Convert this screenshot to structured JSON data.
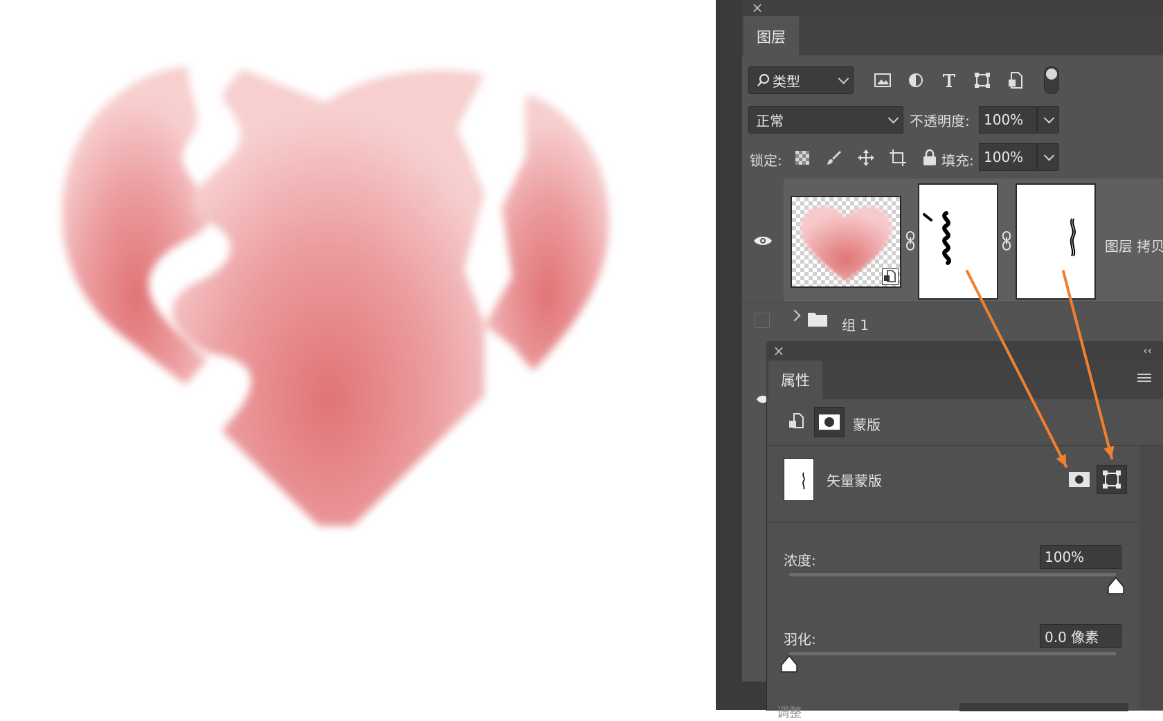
{
  "layers": {
    "tab_label": "图层",
    "filter_label": "类型",
    "blend_mode": "正常",
    "opacity_label": "不透明度:",
    "opacity_value": "100%",
    "lock_label": "锁定:",
    "fill_label": "填充:",
    "fill_value": "100%",
    "layer_name": "图层 拷贝",
    "group_name": "组 1"
  },
  "properties": {
    "tab_label": "属性",
    "mask_label": "蒙版",
    "vector_mask_label": "矢量蒙版",
    "density_label": "浓度:",
    "density_value": "100%",
    "density_percent": 100,
    "feather_label": "羽化:",
    "feather_value": "0.0 像素",
    "feather_percent": 0,
    "cut_label": "调整"
  },
  "colors": {
    "annotation_arrow": "#f08030",
    "heart_dark": "#e07476",
    "heart_light": "#f7cfcf"
  },
  "icons": [
    "close-icon",
    "search-icon",
    "image-filter-icon",
    "adjustment-filter-icon",
    "type-filter-icon",
    "shape-filter-icon",
    "smart-object-filter-icon",
    "filter-toggle-icon",
    "lock-transparent-icon",
    "lock-paint-icon",
    "lock-move-icon",
    "lock-artboard-icon",
    "lock-all-icon",
    "eye-icon",
    "link-icon",
    "folder-icon",
    "collapse-icon",
    "panel-menu-icon",
    "pixel-mask-icon",
    "vector-mask-icon"
  ]
}
